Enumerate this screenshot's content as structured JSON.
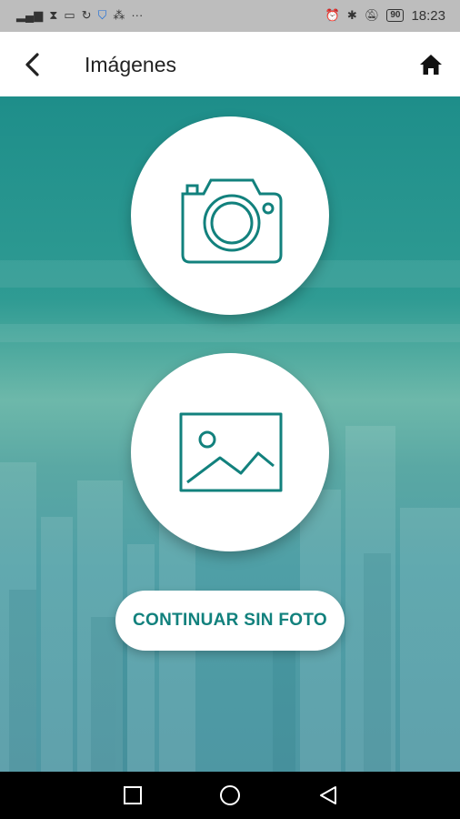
{
  "status_bar": {
    "left_icons": [
      "signal-icon",
      "hourglass-icon",
      "laptop-icon",
      "sync-icon",
      "shield-icon",
      "cluster-icon",
      "more-icon"
    ],
    "battery": "90",
    "time": "18:23"
  },
  "app_bar": {
    "title": "Imágenes",
    "back_icon": "arrow-back-icon",
    "home_icon": "home-icon"
  },
  "actions": {
    "camera_icon": "camera-icon",
    "gallery_icon": "image-icon",
    "continue_label": "CONTINUAR SIN FOTO"
  },
  "colors": {
    "accent": "#12817d",
    "statusbar": "#bdbdbd",
    "appbar": "#ffffff",
    "background_top": "#1e8e8a",
    "background_mid": "#6db8aa"
  },
  "nav_bar": {
    "icons": [
      "recents-square-icon",
      "home-circle-icon",
      "back-triangle-icon"
    ]
  }
}
